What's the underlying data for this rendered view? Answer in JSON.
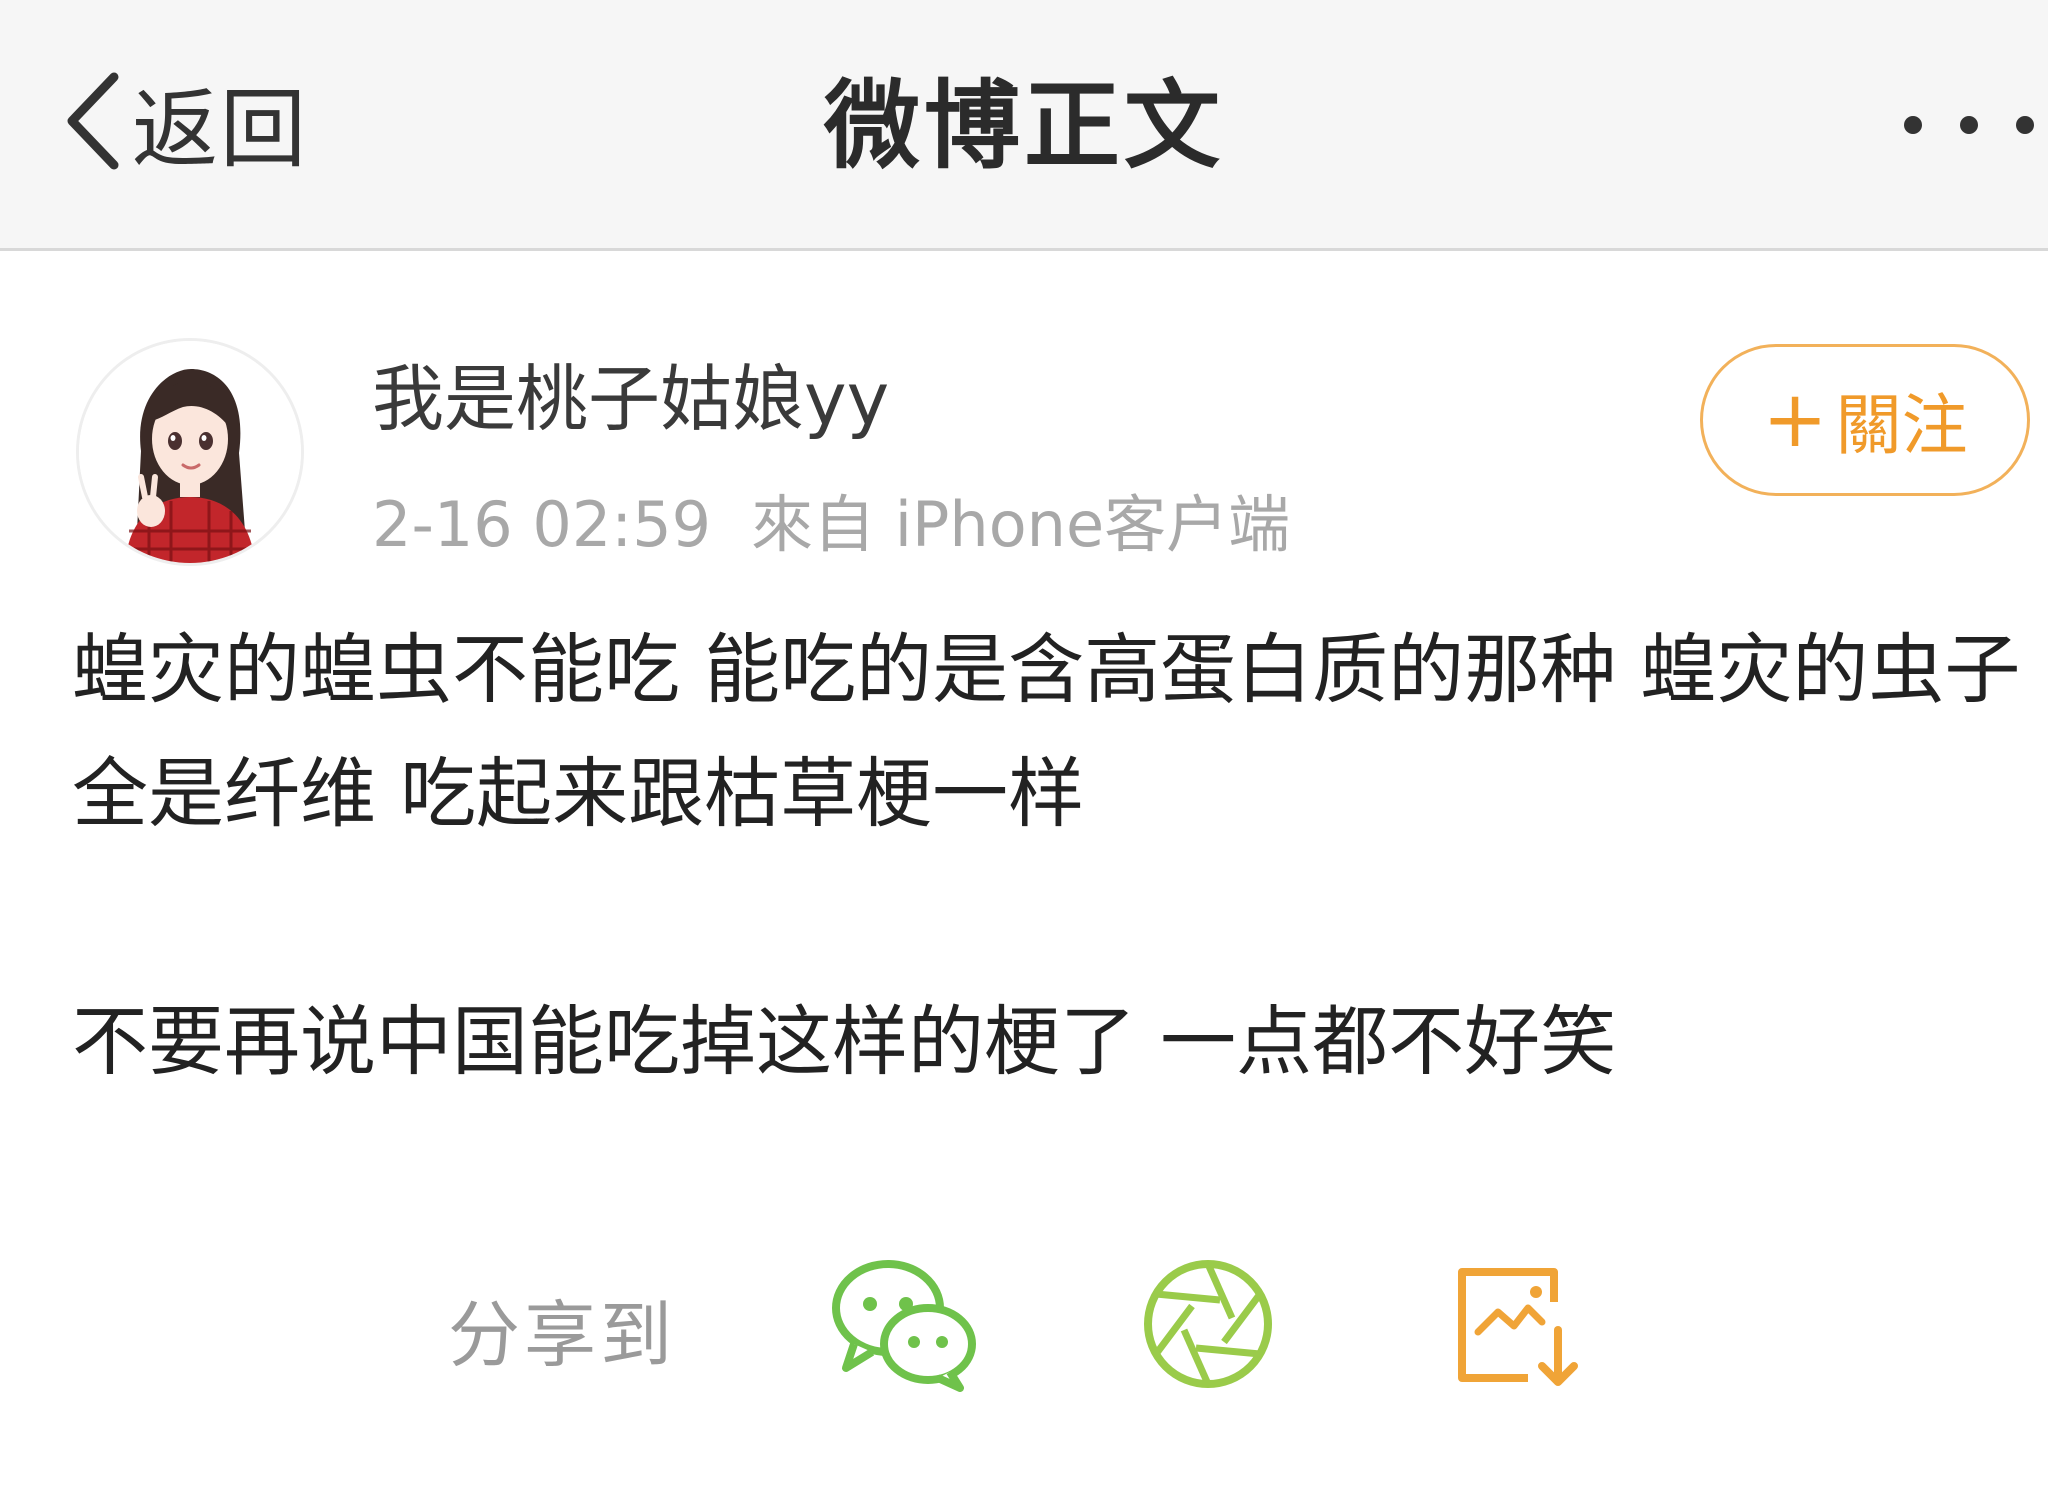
{
  "header": {
    "back_label": "返回",
    "title": "微博正文"
  },
  "author": {
    "name": "我是桃子姑娘yy",
    "timestamp": "2-16 02:59",
    "source": "來自 iPhone客户端",
    "follow_label": "關注"
  },
  "post": {
    "paragraphs": [
      "蝗灾的蝗虫不能吃 能吃的是含高蛋白质的那种 蝗灾的虫子全是纤维 吃起来跟枯草梗一样",
      "不要再说中国能吃掉这样的梗了 一点都不好笑"
    ]
  },
  "share": {
    "label": "分享到",
    "targets": [
      "wechat-icon",
      "moments-icon",
      "save-image-icon"
    ]
  },
  "colors": {
    "accent_orange": "#f09a2a",
    "wechat_green": "#6fc24b",
    "moments_green": "#9acb4a",
    "meta_gray": "#a8a8a8"
  }
}
